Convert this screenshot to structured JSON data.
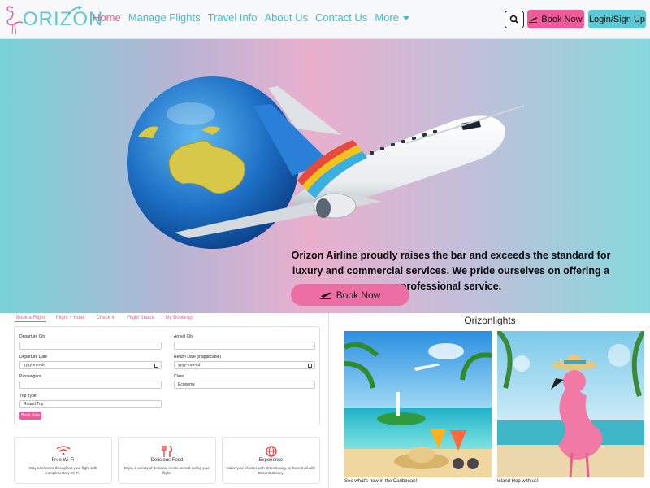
{
  "brand": {
    "name": "ORIZON"
  },
  "nav": {
    "links": [
      {
        "label": "Home",
        "active": true
      },
      {
        "label": "Manage Flights"
      },
      {
        "label": "Travel Info"
      },
      {
        "label": "About Us"
      },
      {
        "label": "Contact Us"
      },
      {
        "label": "More"
      }
    ],
    "book_label": "Book Now",
    "login_label": "Login/Sign Up"
  },
  "hero": {
    "text": "Orizon Airline proudly raises the bar and exceeds the standard for luxury and commercial services. We pride ourselves on offering a professional service.",
    "button_label": "Book Now"
  },
  "booking": {
    "tabs": [
      "Book a Flight",
      "Flight + Hotel",
      "Check In",
      "Flight Status",
      "My Bookings"
    ],
    "departure_city_label": "Departure City",
    "arrival_city_label": "Arrival City",
    "departure_date_label": "Departure Date",
    "departure_date_placeholder": "yyyy-mm-dd",
    "return_date_label": "Return Date (if applicable)",
    "return_date_placeholder": "yyyy-mm-dd",
    "passengers_label": "Passengers",
    "class_label": "Class",
    "class_value": "Economy",
    "trip_type_label": "Trip Type",
    "trip_type_value": "Round Trip",
    "submit_label": "Book Now"
  },
  "features": [
    {
      "title": "Free Wi-Fi",
      "desc": "Stay connected throughout your flight with complimentary Wi-Fi.",
      "icon": "wifi-icon"
    },
    {
      "title": "Delicious Food",
      "desc": "Enjoy a variety of delicious meals served during your flight.",
      "icon": "utensils-icon"
    },
    {
      "title": "Experience",
      "desc": "Make your choices with Orizonluxury, or have it all with OrizonOdessey.",
      "icon": "globe-icon"
    }
  ],
  "highlights": {
    "title": "Orizonlights",
    "cards": [
      {
        "caption": "See what's new in the Caribbean!"
      },
      {
        "caption": "Island Hop with us!"
      }
    ]
  },
  "colors": {
    "pink": "#ec5c98",
    "teal": "#3fbfc7",
    "teal_button": "#5ec9d6"
  }
}
